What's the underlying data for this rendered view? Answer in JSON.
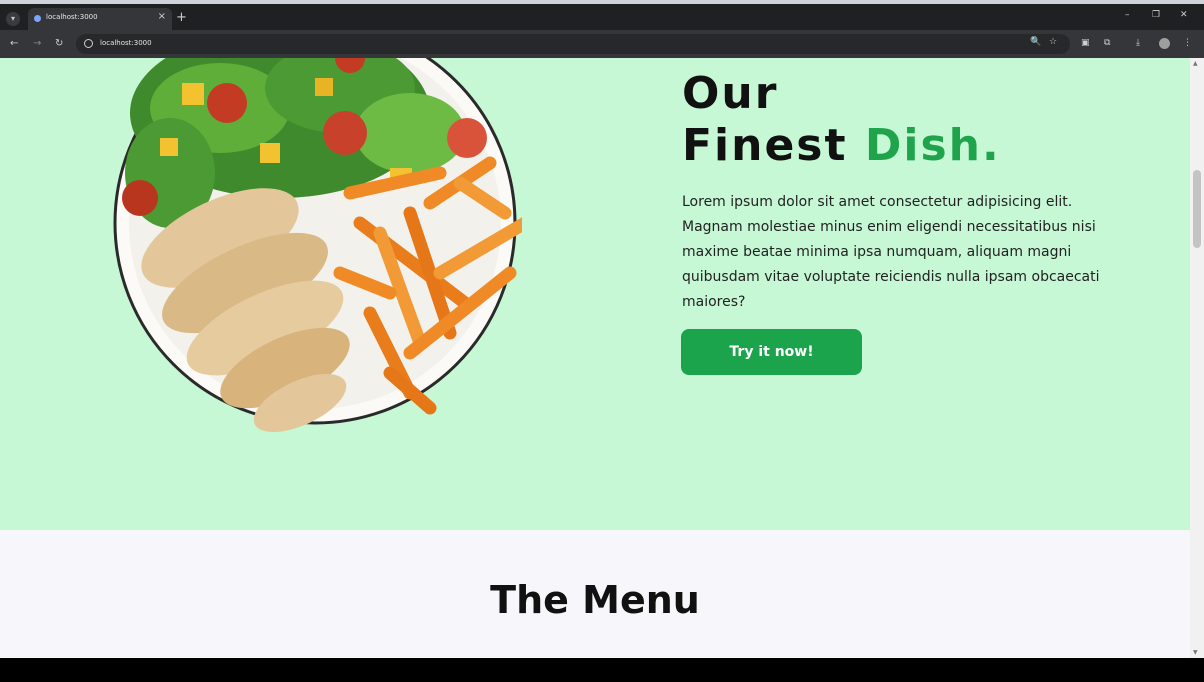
{
  "browser": {
    "tab_title": "localhost:3000",
    "url": "localhost:3000",
    "new_tab_symbol": "+",
    "tab_close_symbol": "×",
    "icons": [
      "tab-search-icon",
      "favicon-icon",
      "close-icon",
      "plus-icon",
      "minimize-icon",
      "restore-icon",
      "window-close-icon",
      "back-icon",
      "forward-icon",
      "reload-icon",
      "site-info-icon",
      "zoom-icon",
      "star-icon",
      "extension-icon",
      "puzzle-icon",
      "download-icon",
      "profile-icon",
      "more-icon"
    ]
  },
  "hero": {
    "title_line1": "Our",
    "title_line2_start": "Finest",
    "title_accent": "Dish.",
    "description": "Lorem ipsum dolor sit amet consectetur adipisicing elit. Magnam molestiae minus enim eligendi necessitatibus nisi maxime beatae minima ipsa numquam, aliquam magni quibusdam vitae voluptate reiciendis nulla ipsam obcaecati maiores?",
    "cta_label": "Try it now!",
    "image_subject": "plate with salad, grilled chicken and fries"
  },
  "menu": {
    "title": "The Menu"
  },
  "colors": {
    "hero_bg": "#c6f8d5",
    "accent": "#1fa44c",
    "button_bg": "#1ba44c",
    "menu_bg": "#f7f7fb",
    "browser_dark": "#1f2022"
  }
}
